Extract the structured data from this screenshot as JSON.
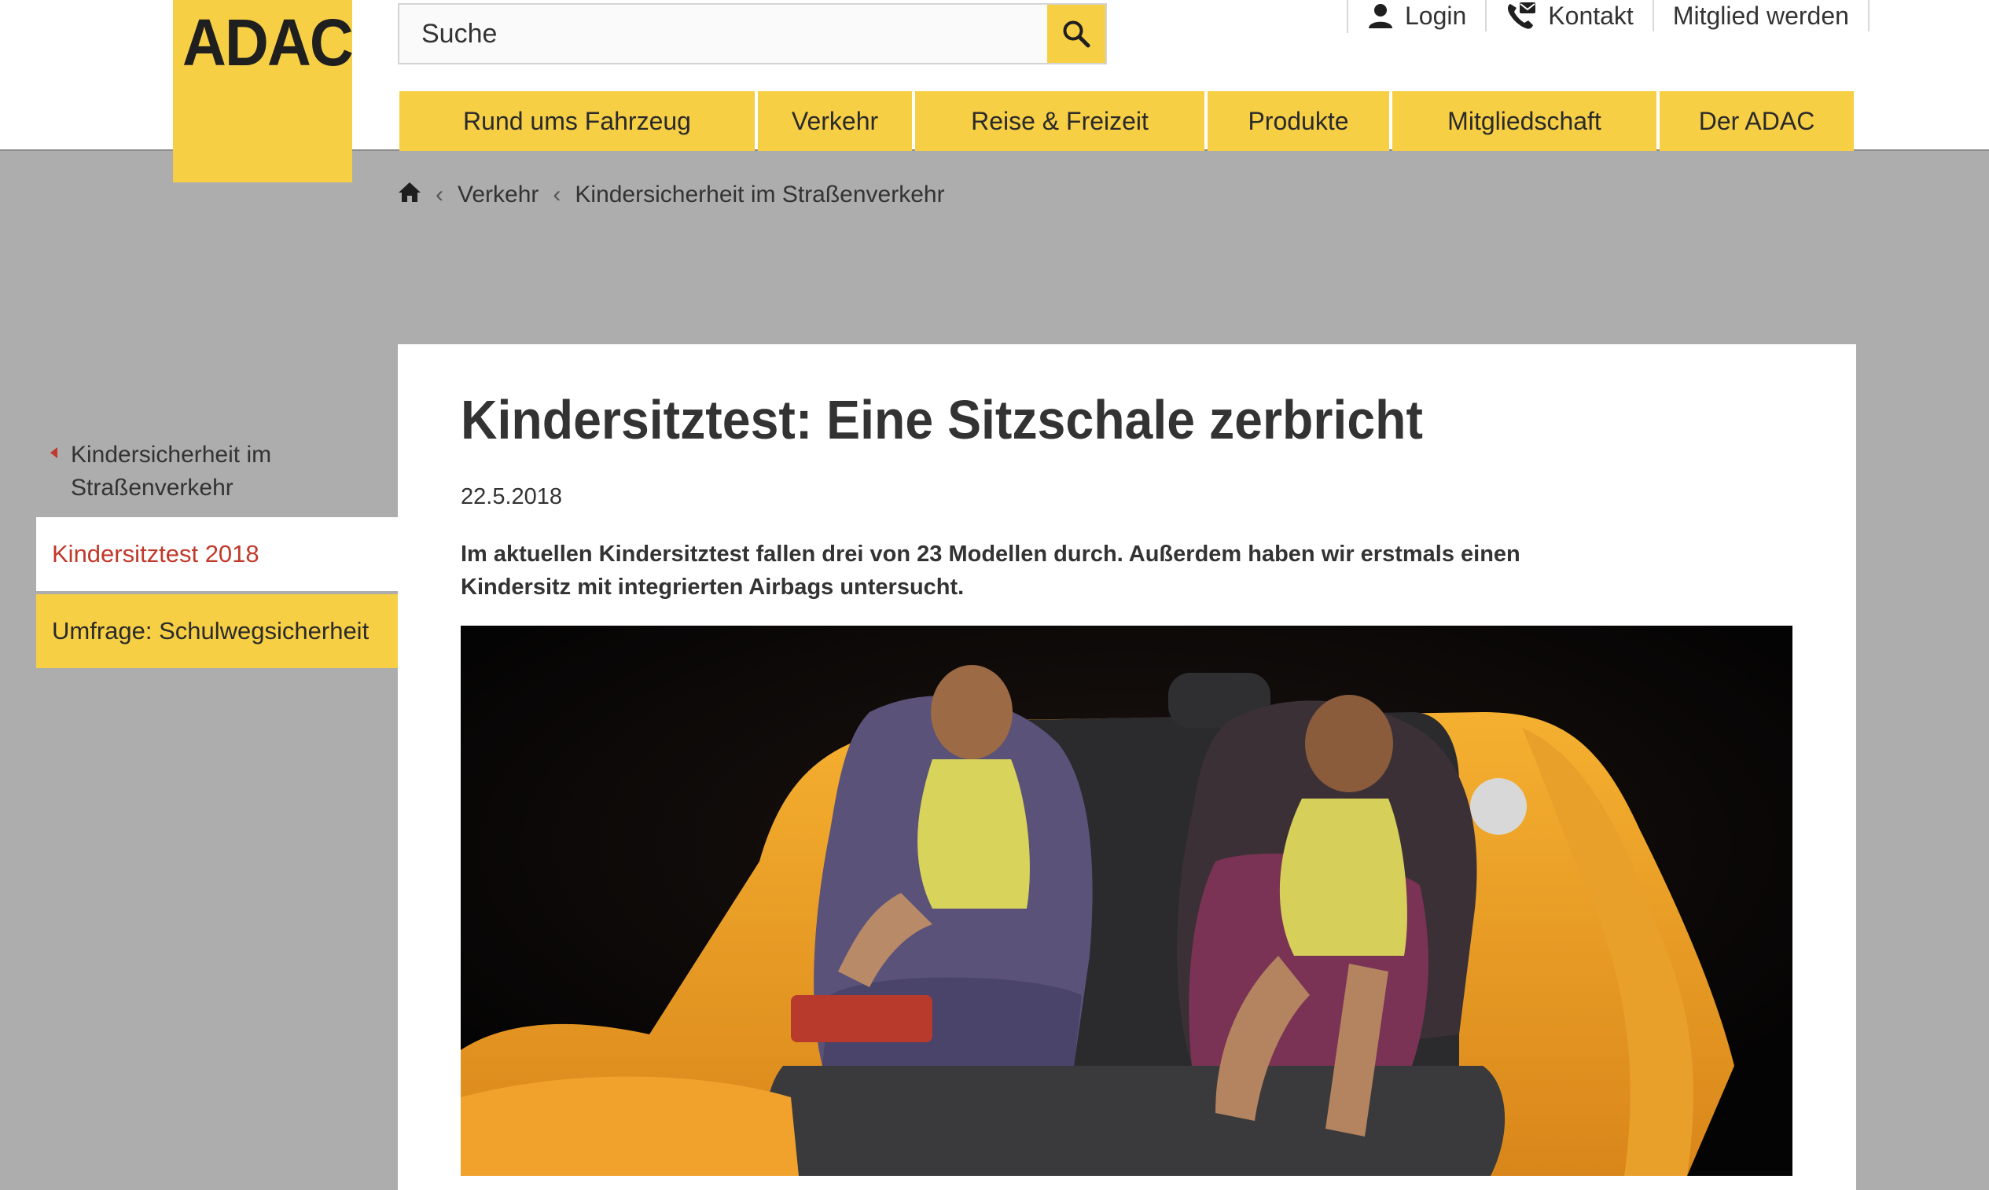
{
  "brand": {
    "logo_text": "ADAC"
  },
  "search": {
    "placeholder": "Suche"
  },
  "meta_nav": [
    {
      "label": "Login",
      "icon": "user-icon"
    },
    {
      "label": "Kontakt",
      "icon": "phone-mail-icon"
    },
    {
      "label": "Mitglied werden"
    }
  ],
  "main_nav": [
    "Rund ums Fahrzeug",
    "Verkehr",
    "Reise & Freizeit",
    "Produkte",
    "Mitgliedschaft",
    "Der ADAC"
  ],
  "breadcrumb": {
    "home_icon": "home-icon",
    "items": [
      "Verkehr",
      "Kindersicherheit im Straßenverkehr"
    ]
  },
  "sidebar": {
    "parent": "Kindersicherheit im Straßenverkehr",
    "active": "Kindersitztest 2018",
    "items": [
      "Umfrage: Schulwegsicherheit"
    ]
  },
  "article": {
    "title": "Kindersitztest: Eine Sitzschale zerbricht",
    "date": "22.5.2018",
    "lead": "Im aktuellen Kindersitztest fallen drei von 23 Modellen durch. Außerdem haben wir erstmals einen Kindersitz mit integrierten Airbags untersucht."
  },
  "colors": {
    "brand_yellow": "#f7cf45",
    "page_gray": "#adadad",
    "active_red": "#c0392b",
    "text": "#333333"
  }
}
